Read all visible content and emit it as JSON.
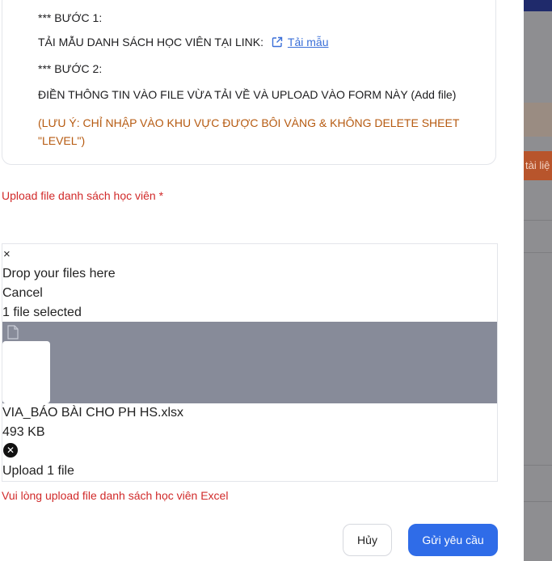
{
  "instructions": {
    "step1_title": "*** BƯỚC 1:",
    "step1_text": "TẢI MẪU DANH SÁCH HỌC VIÊN TẠI LINK:",
    "template_link": "Tải mẫu",
    "step2_title": "*** BƯỚC 2:",
    "step2_text": "ĐIỀN THÔNG TIN VÀO FILE VỪA TẢI VỀ VÀ UPLOAD VÀO FORM NÀY (Add file)",
    "note": "(LƯU Ý: CHỈ NHẬP VÀO KHU VỰC ĐƯỢC BÔI VÀNG & KHÔNG DELETE SHEET \"LEVEL\")"
  },
  "upload": {
    "label": "Upload file danh sách học viên *",
    "close_symbol": "×",
    "drop_text": "Drop your files here",
    "cancel_text": "Cancel",
    "selected_text": "1 file selected",
    "file_name": "VIA_BÁO BÀI CHO PH HS.xlsx",
    "file_size": "493 KB",
    "remove_symbol": "✕",
    "upload_button": "Upload 1 file"
  },
  "error": "Vui lòng upload file danh sách học viên Excel",
  "actions": {
    "cancel": "Hủy",
    "submit": "Gửi yêu cầu"
  },
  "backdrop": {
    "partial_button": "tài liệ"
  },
  "colors": {
    "primary": "#2f6ce8",
    "error": "#d12a2a",
    "note": "#b65a10",
    "link": "#3a6fd8"
  }
}
